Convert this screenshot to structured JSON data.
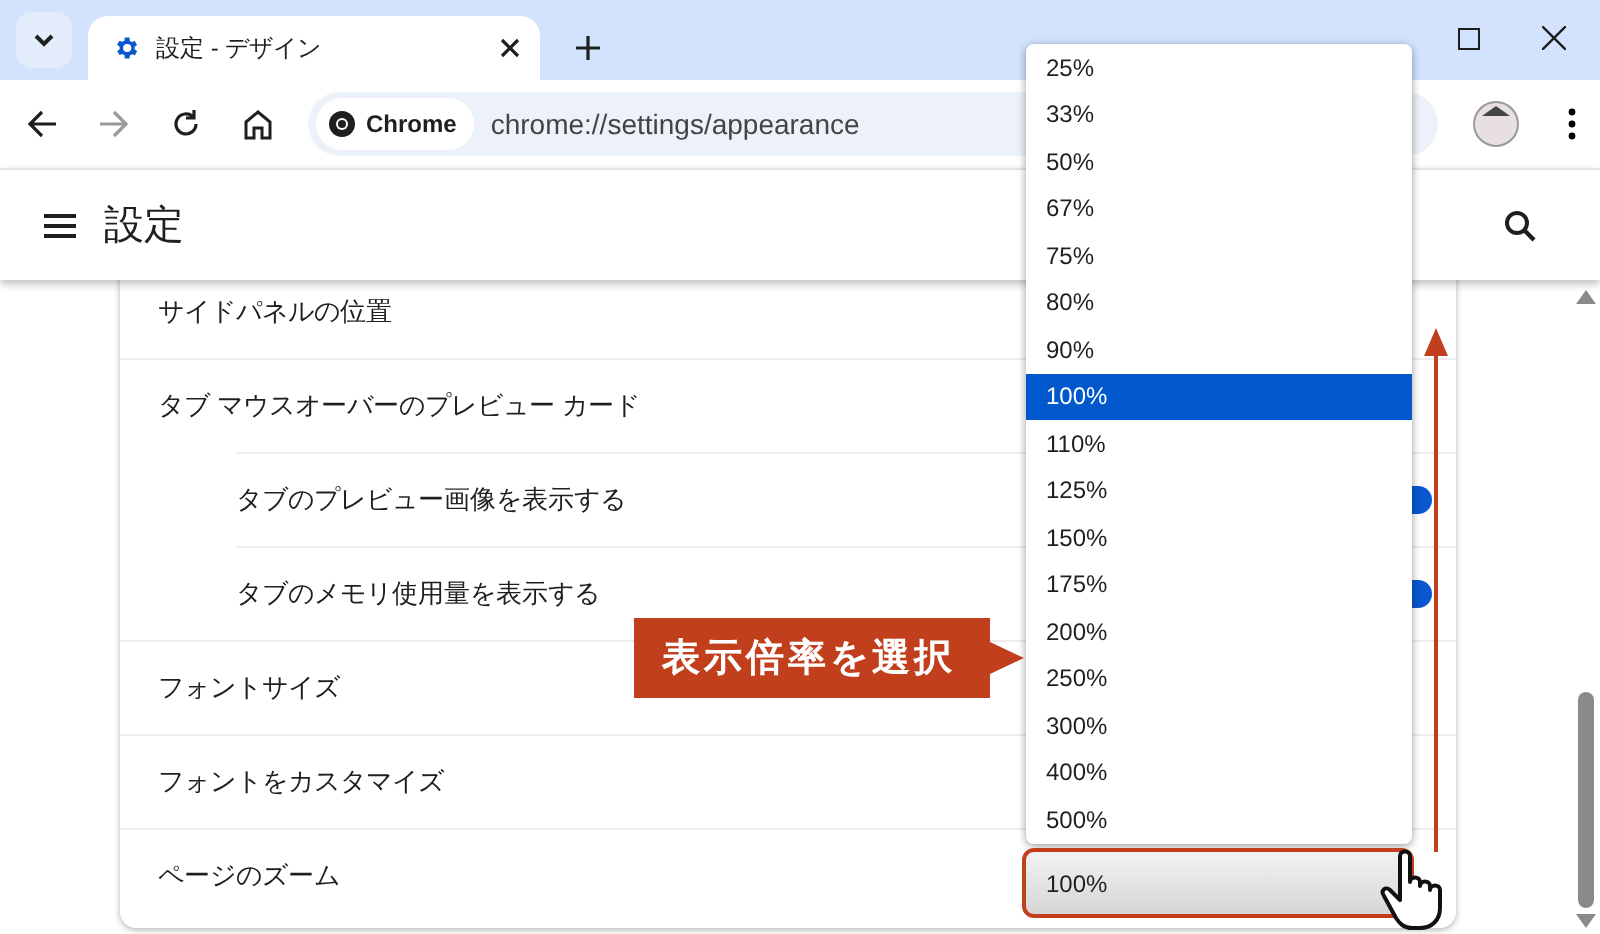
{
  "tab_strip": {
    "tab": {
      "title": "設定 - デザイン",
      "selected": true
    }
  },
  "toolbar": {
    "chip_label": "Chrome",
    "url": "chrome://settings/appearance"
  },
  "header": {
    "title": "設定"
  },
  "rows": [
    {
      "label": "サイドパネルの位置"
    },
    {
      "label": "タブ マウスオーバーのプレビュー カード",
      "children": [
        {
          "label": "タブのプレビュー画像を表示する",
          "on": true
        },
        {
          "label": "タブのメモリ使用量を表示する",
          "on": true
        }
      ]
    },
    {
      "label": "フォントサイズ"
    },
    {
      "label": "フォントをカスタマイズ"
    },
    {
      "label": "ページのズーム"
    }
  ],
  "zoom_select": {
    "value": "100%",
    "options": [
      {
        "label": "25%",
        "selected": false
      },
      {
        "label": "33%",
        "selected": false
      },
      {
        "label": "50%",
        "selected": false
      },
      {
        "label": "67%",
        "selected": false
      },
      {
        "label": "75%",
        "selected": false
      },
      {
        "label": "80%",
        "selected": false
      },
      {
        "label": "90%",
        "selected": false
      },
      {
        "label": "100%",
        "selected": true
      },
      {
        "label": "110%",
        "selected": false
      },
      {
        "label": "125%",
        "selected": false
      },
      {
        "label": "150%",
        "selected": false
      },
      {
        "label": "175%",
        "selected": false
      },
      {
        "label": "200%",
        "selected": false
      },
      {
        "label": "250%",
        "selected": false
      },
      {
        "label": "300%",
        "selected": false
      },
      {
        "label": "400%",
        "selected": false
      },
      {
        "label": "500%",
        "selected": false
      }
    ]
  },
  "callout": {
    "text": "表示倍率を選択"
  }
}
